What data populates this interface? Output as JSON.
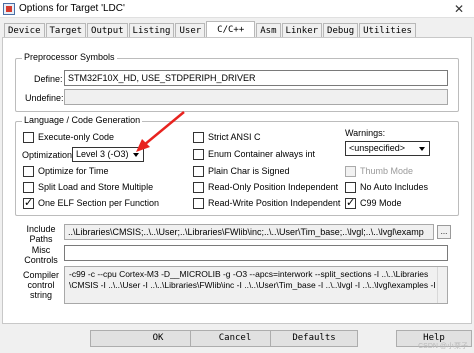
{
  "window": {
    "title": "Options for Target 'LDC'"
  },
  "tabs": [
    "Device",
    "Target",
    "Output",
    "Listing",
    "User",
    "C/C++",
    "Asm",
    "Linker",
    "Debug",
    "Utilities"
  ],
  "preprocessor": {
    "group_title": "Preprocessor Symbols",
    "define_label": "Define:",
    "define_value": "STM32F10X_HD, USE_STDPERIPH_DRIVER",
    "undefine_label": "Undefine:",
    "undefine_value": ""
  },
  "language": {
    "group_title": "Language / Code Generation",
    "execute_only": {
      "label": "Execute-only Code",
      "checked": false
    },
    "optimization_label": "Optimization:",
    "optimization_value": "Level 3 (-O3)",
    "optimize_time": {
      "label": "Optimize for Time",
      "checked": false
    },
    "split_load": {
      "label": "Split Load and Store Multiple",
      "checked": false
    },
    "one_elf": {
      "label": "One ELF Section per Function",
      "checked": true
    },
    "strict_ansi": {
      "label": "Strict ANSI C",
      "checked": false
    },
    "enum_int": {
      "label": "Enum Container always int",
      "checked": false
    },
    "plain_char": {
      "label": "Plain Char is Signed",
      "checked": false
    },
    "ro_pi": {
      "label": "Read-Only Position Independent",
      "checked": false
    },
    "rw_pi": {
      "label": "Read-Write Position Independent",
      "checked": false
    },
    "warnings_label": "Warnings:",
    "warnings_value": "<unspecified>",
    "thumb_mode": {
      "label": "Thumb Mode",
      "checked": false,
      "disabled": true
    },
    "no_auto_includes": {
      "label": "No Auto Includes",
      "checked": false
    },
    "c99_mode": {
      "label": "C99 Mode",
      "checked": true
    }
  },
  "include_paths": {
    "label_line1": "Include",
    "label_line2": "Paths",
    "value": "..\\Libraries\\CMSIS;..\\..\\User;..\\Libraries\\FWlib\\inc;..\\..\\User\\Tim_base;..\\lvgl;..\\..\\lvgl\\examp",
    "browse_label": "..."
  },
  "misc_controls": {
    "label_line1": "Misc",
    "label_line2": "Controls",
    "value": ""
  },
  "compiler_string": {
    "label_line1": "Compiler",
    "label_line2": "control",
    "label_line3": "string",
    "line1": "-c99 -c --cpu Cortex-M3 -D__MICROLIB -g -O3 --apcs=interwork --split_sections -I ..\\..\\Libraries",
    "line2": "\\CMSIS -I ..\\..\\User -I ..\\..\\Libraries\\FWlib\\inc -I ..\\..\\User\\Tim_base -I ..\\..\\lvgl -I ..\\..\\lvgl\\examples -I ..\\..\\"
  },
  "buttons": {
    "ok": "OK",
    "cancel": "Cancel",
    "defaults": "Defaults",
    "help": "Help"
  },
  "watermark": "CSDN @小栗子"
}
